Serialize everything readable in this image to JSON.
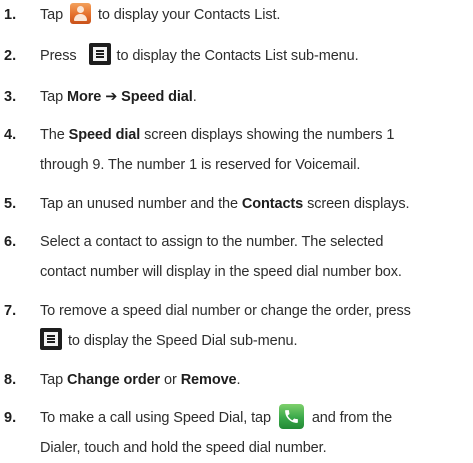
{
  "steps": [
    {
      "number": "1.",
      "text_a": "Tap",
      "icon": "contacts-app-icon",
      "text_b": "to display your Contacts List."
    },
    {
      "number": "2.",
      "text_a": "Press",
      "icon": "menu-key-icon",
      "text_b": "to display the Contacts List sub-menu."
    },
    {
      "number": "3.",
      "text_a": "Tap",
      "bold": "More ➔ Speed dial",
      "text_b": "."
    },
    {
      "number": "4.",
      "text_a": "The",
      "bold": "Speed dial",
      "text_b": "screen displays showing the numbers 1",
      "line2": "through 9. The number 1 is reserved for Voicemail."
    },
    {
      "number": "5.",
      "text_a": "Tap an unused number and the",
      "bold": "Contacts",
      "text_b": "screen displays."
    },
    {
      "number": "6.",
      "line1": "Select a contact to assign to the number. The selected",
      "line2": "contact number will display in the speed dial number box."
    },
    {
      "number": "7.",
      "line1": "To remove a speed dial number or change the order, press",
      "icon": "menu-key-icon",
      "line2": "to display the Speed Dial sub-menu."
    },
    {
      "number": "8.",
      "text_a": "Tap",
      "bold_a": "Change order",
      "text_b": "or",
      "bold_b": "Remove",
      "text_c": "."
    },
    {
      "number": "9.",
      "text_a": "To make a call using Speed Dial, tap",
      "icon": "phone-dialer-icon",
      "text_b": "and from the",
      "line2": "Dialer, touch and hold the speed dial number."
    }
  ],
  "colors": {
    "contacts_icon": "#e5702b",
    "menu_icon": "#1d1d1d",
    "phone_icon": "#3aa84a"
  }
}
